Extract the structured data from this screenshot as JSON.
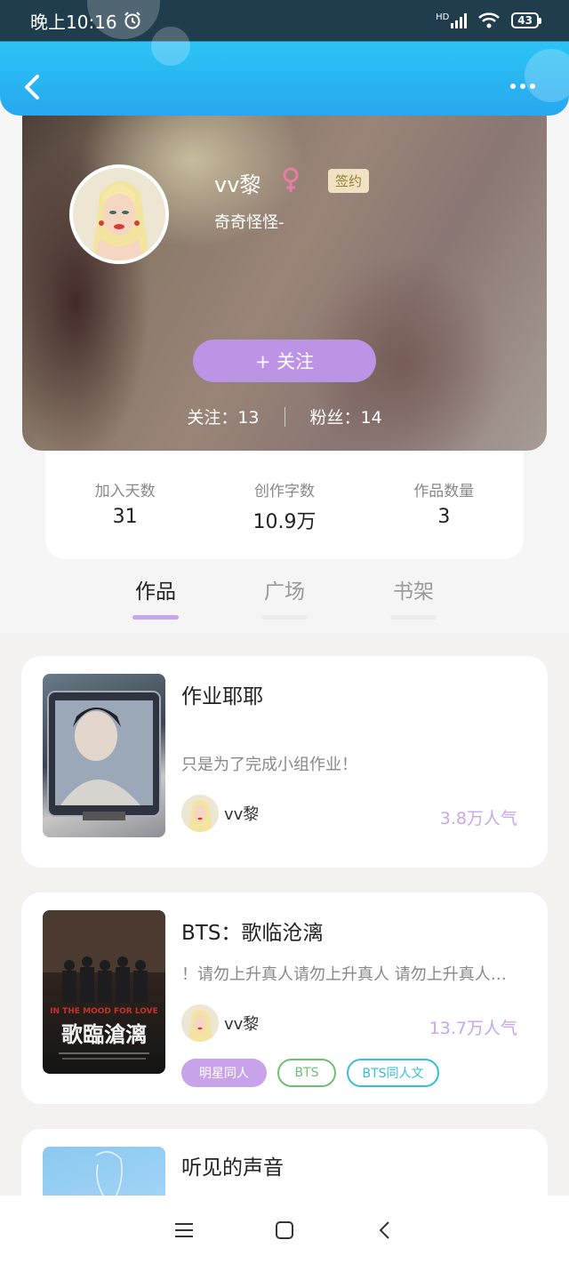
{
  "status_bar": {
    "time": "晚上10:16",
    "network": "HD",
    "battery": "43"
  },
  "profile": {
    "name": "vv黎",
    "badge": "签约",
    "bio": "奇奇怪怪-",
    "follow_button": "+  关注",
    "following": "关注：13",
    "fans": "粉丝：14"
  },
  "stats": [
    {
      "label": "加入天数",
      "value": "31"
    },
    {
      "label": "创作字数",
      "value": "10.9万"
    },
    {
      "label": "作品数量",
      "value": "3"
    }
  ],
  "tabs": [
    {
      "label": "作品",
      "active": true
    },
    {
      "label": "广场",
      "active": false
    },
    {
      "label": "书架",
      "active": false
    }
  ],
  "works": [
    {
      "title": "作业耶耶",
      "desc": "只是为了完成小组作业！",
      "author": "vv黎",
      "popularity": "3.8万人气",
      "tags": []
    },
    {
      "title": "BTS：歌临沧漓",
      "desc": "！请勿上升真人请勿上升真人  请勿上升真人请勿上升真人",
      "author": "vv黎",
      "popularity": "13.7万人气",
      "cover_text_small": "IN THE MOOD FOR LOVE",
      "cover_text_big": "歌臨滄漓",
      "tags": [
        "明星同人",
        "BTS",
        "BTS同人文"
      ]
    },
    {
      "title": "听见的声音",
      "desc": "",
      "author": "",
      "popularity": "",
      "tags": []
    }
  ],
  "colors": {
    "accent_purple": "#bd93e6",
    "header_blue": "#27a7f0",
    "tag_green": "#6dbf73",
    "tag_cyan": "#36c0d8"
  }
}
